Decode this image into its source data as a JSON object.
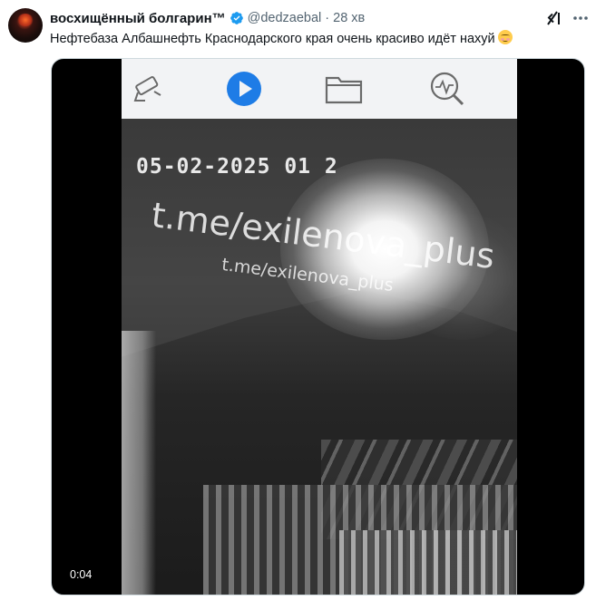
{
  "author": {
    "display_name": "восхищённый болгарин™",
    "handle": "@dedzaebal",
    "separator": "·",
    "time_ago": "28 хв",
    "verified": true,
    "verified_color": "#1d9bf0"
  },
  "tweet": {
    "text": "Нефтебаза Албашнефть  Краснодарского края очень красиво идёт нахуй",
    "emoji": "smiling-face-with-smiling-eyes"
  },
  "media": {
    "type": "video",
    "duration": "0:04",
    "overlay_timestamp": "05-02-2025 01 2",
    "watermark_large": "t.me/exilenova_plus",
    "watermark_small": "t.me/exilenova_plus",
    "toolbar_icons": [
      "camera-icon",
      "play-icon",
      "folder-icon",
      "search-analytics-icon"
    ]
  },
  "actions": {
    "grok_icon": "grok-icon",
    "more_icon": "more-icon"
  },
  "colors": {
    "text_primary": "#0f1419",
    "text_secondary": "#536471",
    "play_blue": "#1e7ce6"
  }
}
